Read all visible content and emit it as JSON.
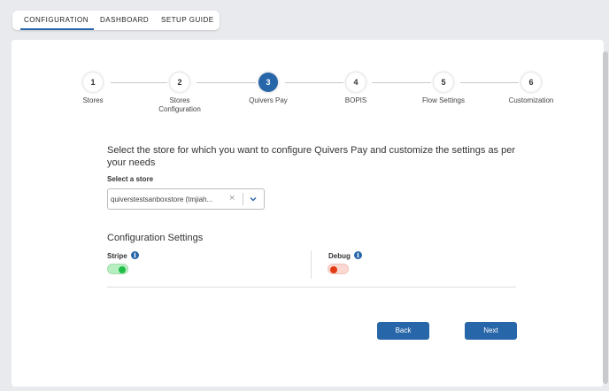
{
  "tabs": [
    {
      "label": "CONFIGURATION",
      "active": true
    },
    {
      "label": "DASHBOARD",
      "active": false
    },
    {
      "label": "SETUP GUIDE",
      "active": false
    }
  ],
  "steps": [
    {
      "number": "1",
      "label": "Stores",
      "active": false
    },
    {
      "number": "2",
      "label_line1": "Stores",
      "label_line2": "Configuration",
      "active": false
    },
    {
      "number": "3",
      "label": "Quivers Pay",
      "active": true
    },
    {
      "number": "4",
      "label": "BOPIS",
      "active": false
    },
    {
      "number": "5",
      "label": "Flow Settings",
      "active": false
    },
    {
      "number": "6",
      "label": "Customization",
      "active": false
    }
  ],
  "main": {
    "headline": "Select the store for which you want to configure Quivers Pay and customize the settings as per your needs",
    "store_label": "Select a store",
    "store_value": "quiverstestsanboxstore (tmjiah...",
    "config_title": "Configuration Settings",
    "stripe": {
      "label": "Stripe",
      "enabled": true
    },
    "debug": {
      "label": "Debug",
      "enabled": false
    }
  },
  "buttons": {
    "back": "Back",
    "next": "Next"
  },
  "icons": {
    "info": "info-icon",
    "clear": "close-icon",
    "dropdown": "chevron-down-icon"
  },
  "colors": {
    "accent": "#2766a8",
    "toggle_on": "#1fbe48",
    "toggle_off": "#e23a12",
    "background": "#e8eaed"
  }
}
